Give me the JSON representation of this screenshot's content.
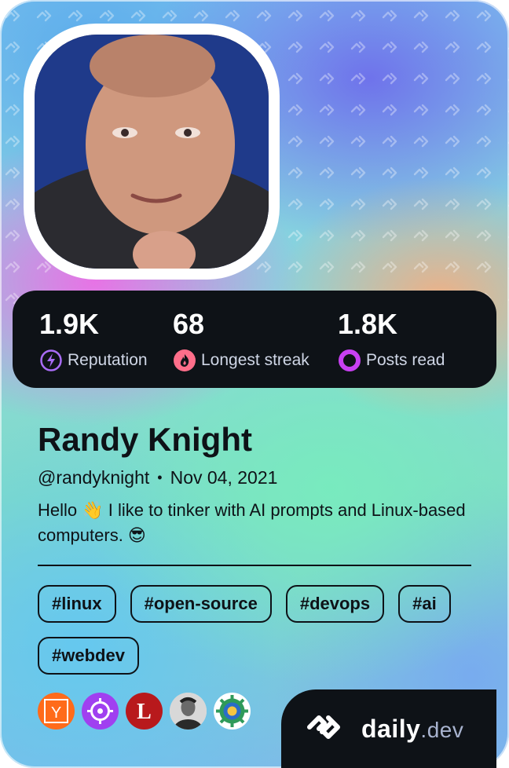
{
  "profile": {
    "name": "Randy Knight",
    "handle": "@randyknight",
    "separator": "•",
    "joined": "Nov 04, 2021",
    "bio": "Hello 👋 I like to tinker with AI prompts and Linux-based computers. 😎"
  },
  "stats": [
    {
      "value": "1.9K",
      "label": "Reputation",
      "icon": "lightning-icon",
      "color": "#a96cf7"
    },
    {
      "value": "68",
      "label": "Longest streak",
      "icon": "flame-icon",
      "color": "#ff6e8a"
    },
    {
      "value": "1.8K",
      "label": "Posts read",
      "icon": "eye-ring-icon",
      "color": "#c840f2"
    }
  ],
  "tags": [
    "#linux",
    "#open-source",
    "#devops",
    "#ai",
    "#webdev"
  ],
  "sources": [
    {
      "name": "y-source-icon",
      "letter": "Y",
      "color": "#ff6b1a"
    },
    {
      "name": "crosshair-source-icon",
      "color": "#a040f0"
    },
    {
      "name": "l-source-icon",
      "letter": "L",
      "color": "#b8191c"
    },
    {
      "name": "person-source-icon",
      "color": "#e6e6e6"
    },
    {
      "name": "gear-source-icon",
      "color": "#ffffff"
    }
  ],
  "brand": {
    "word": "daily",
    "suffix": ".dev"
  },
  "colors": {
    "dark": "#0e1217",
    "text": "#0e1217",
    "label": "#cfd6e6"
  }
}
